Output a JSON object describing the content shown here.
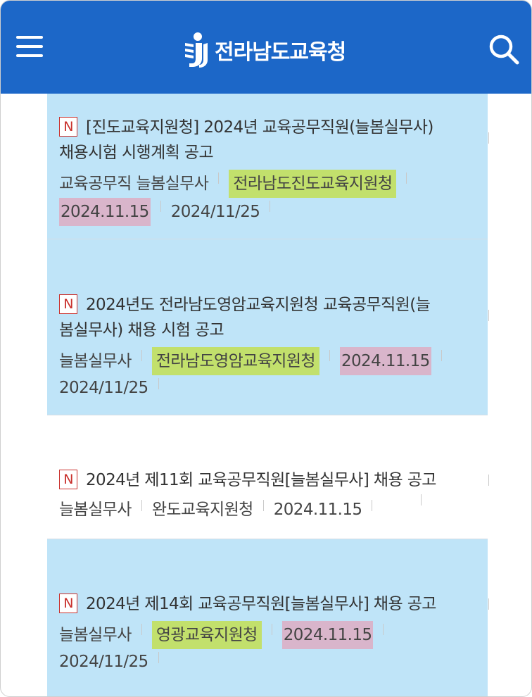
{
  "header": {
    "title": "전라남도교육청",
    "colors": {
      "bar": "#1c67c8",
      "highlight_row": "#bfe4f8",
      "highlight_green": "#c2e06c",
      "highlight_pink": "#d9b5cb",
      "new_badge": "#c9302c"
    },
    "icons": [
      "menu-icon",
      "logo-icon",
      "search-icon"
    ]
  },
  "items": [
    {
      "badge": "N",
      "title_line1": "[진도교육지원청] 2024년 교육공무직원(늘봄실무사)",
      "title_line2": "채용시험 시행계획 공고",
      "category": "교육공무직 늘봄실무사",
      "office": "전라남도진도교육지원청",
      "start_date": "2024.11.15",
      "end_date": "2024/11/25"
    },
    {
      "badge": "N",
      "title_line1": "2024년도 전라남도영암교육지원청 교육공무직원(늘",
      "title_line2": "봄실무사) 채용 시험 공고",
      "category": "늘봄실무사",
      "office": "전라남도영암교육지원청",
      "start_date": "2024.11.15",
      "end_date": "2024/11/25"
    },
    {
      "badge": "N",
      "title_line1": "2024년 제11회 교육공무직원[늘봄실무사] 채용 공고",
      "category": "늘봄실무사",
      "office": "완도교육지원청",
      "start_date": "2024.11.15"
    },
    {
      "badge": "N",
      "title_line1": "2024년 제14회 교육공무직원[늘봄실무사] 채용 공고",
      "category": "늘봄실무사",
      "office": "영광교육지원청",
      "start_date": "2024.11.15",
      "end_date": "2024/11/25"
    }
  ]
}
